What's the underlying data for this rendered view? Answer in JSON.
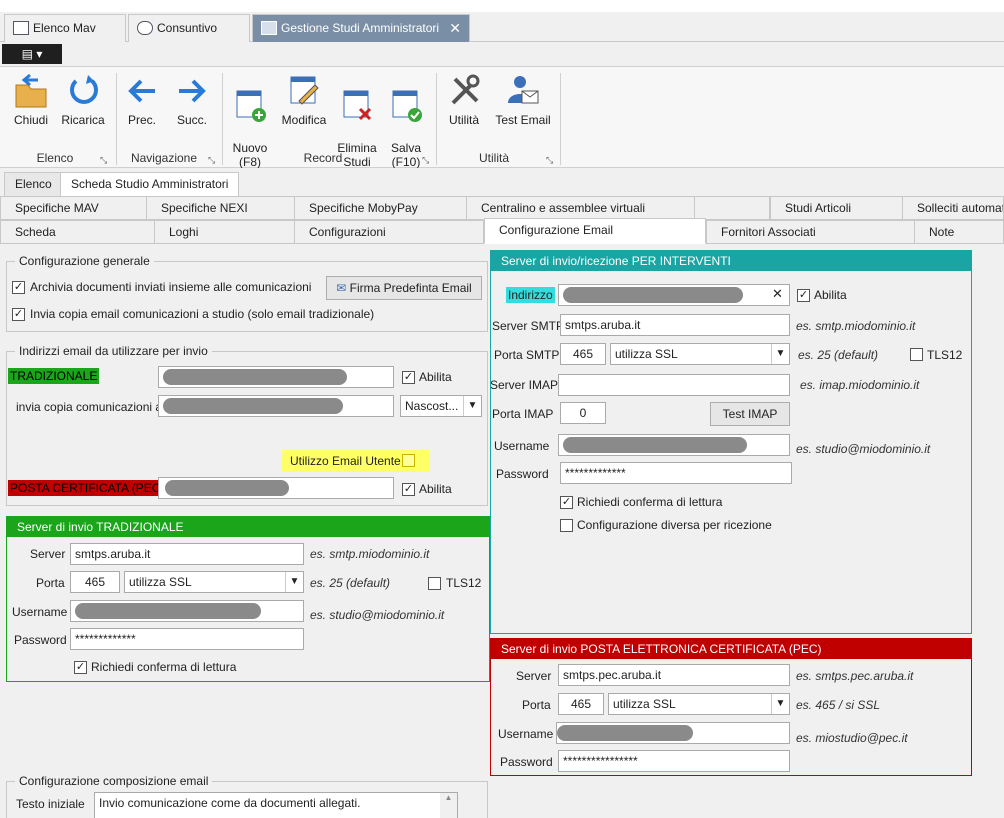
{
  "doc_tabs": [
    "Elenco Mav",
    "Consuntivo",
    "Gestione Studi Amministratori"
  ],
  "close_glyph": "✕",
  "ribbon": {
    "buttons": [
      {
        "label": "Chiudi",
        "icon": "folder-open-icon"
      },
      {
        "label": "Ricarica",
        "icon": "refresh-icon"
      },
      {
        "label": "Prec.",
        "icon": "arrow-left-icon"
      },
      {
        "label": "Succ.",
        "icon": "arrow-right-icon"
      },
      {
        "label": "Nuovo\n(F8)",
        "icon": "new-record-icon"
      },
      {
        "label": "Modifica",
        "icon": "edit-record-icon"
      },
      {
        "label": "Elimina\nStudi",
        "icon": "delete-record-icon"
      },
      {
        "label": "Salva\n(F10)",
        "icon": "save-record-icon"
      },
      {
        "label": "Utilità",
        "icon": "tools-icon"
      },
      {
        "label": "Test Email",
        "icon": "email-user-icon"
      }
    ],
    "groups": [
      "Elenco",
      "Navigazione",
      "Record",
      "Utilità"
    ]
  },
  "sub_tabs": [
    "Elenco",
    "Scheda Studio Amministratori"
  ],
  "tabs_row1": [
    "Specifiche MAV",
    "Specifiche NEXI",
    "Specifiche MobyPay",
    "Centralino e assemblee virtuali",
    "",
    "Studi Articoli",
    "Solleciti automati"
  ],
  "tabs_row2": [
    "Scheda",
    "Loghi",
    "Configurazioni",
    "Configurazione Email",
    "Fornitori Associati",
    "Note"
  ],
  "general": {
    "legend": "Configurazione generale",
    "archive_label": "Archivia documenti inviati insieme alle comunicazioni",
    "copy_label": "Invia copia email comunicazioni a studio (solo email tradizionale)",
    "firma_button": "Firma Predefinta Email"
  },
  "addresses": {
    "legend": "Indirizzi email da utilizzare per invio",
    "trad_label": "TRADIZIONALE",
    "abilita": "Abilita",
    "copy_to_label": "invia copia comunicazioni a",
    "copy_to_value": "Nascost...",
    "user_email_label": "Utilizzo Email Utente",
    "pec_label": "POSTA CERTIFICATA (PEC)"
  },
  "trad_server": {
    "header": "Server di invio TRADIZIONALE",
    "server_label": "Server",
    "server_value": "smtps.aruba.it",
    "server_hint": "es. smtp.miodominio.it",
    "port_label": "Porta",
    "port_value": "465",
    "ssl_value": "utilizza SSL",
    "port_hint": "es. 25 (default)",
    "tls_label": "TLS12",
    "user_label": "Username",
    "user_hint": "es. studio@miodominio.it",
    "pass_label": "Password",
    "pass_value": "*************",
    "confirm_label": "Richiedi conferma di lettura"
  },
  "compose": {
    "legend": "Configurazione composizione email",
    "text_label": "Testo iniziale",
    "text_value": "Invio comunicazione come da documenti allegati."
  },
  "interventi": {
    "header": "Server di invio/ricezione PER INTERVENTI",
    "address_label": "Indirizzo",
    "abilita": "Abilita",
    "smtp_label": "Server SMTP",
    "smtp_value": "smtps.aruba.it",
    "smtp_hint": "es. smtp.miodominio.it",
    "smtp_port_label": "Porta SMTP",
    "smtp_port_value": "465",
    "ssl_value": "utilizza SSL",
    "smtp_port_hint": "es. 25 (default)",
    "tls_label": "TLS12",
    "imap_label": "Server IMAP",
    "imap_hint": "es. imap.miodominio.it",
    "imap_port_label": "Porta IMAP",
    "imap_port_value": "0",
    "test_imap": "Test IMAP",
    "user_label": "Username",
    "user_hint": "es. studio@miodominio.it",
    "pass_label": "Password",
    "pass_value": "*************",
    "confirm_label": "Richiedi conferma di lettura",
    "diff_label": "Configurazione diversa per ricezione"
  },
  "pec_server": {
    "header": "Server di invio POSTA ELETTRONICA CERTIFICATA (PEC)",
    "server_label": "Server",
    "server_value": "smtps.pec.aruba.it",
    "server_hint": "es. smtps.pec.aruba.it",
    "port_label": "Porta",
    "port_value": "465",
    "ssl_value": "utilizza SSL",
    "port_hint": "es. 465 / si SSL",
    "user_label": "Username",
    "user_hint": "es. miostudio@pec.it",
    "pass_label": "Password",
    "pass_value": "****************"
  },
  "colors": {
    "green": "#1aa51a",
    "teal": "#1aa5a5",
    "red": "#c00000",
    "yellow": "#ffff66",
    "cyan": "#33dddd"
  }
}
